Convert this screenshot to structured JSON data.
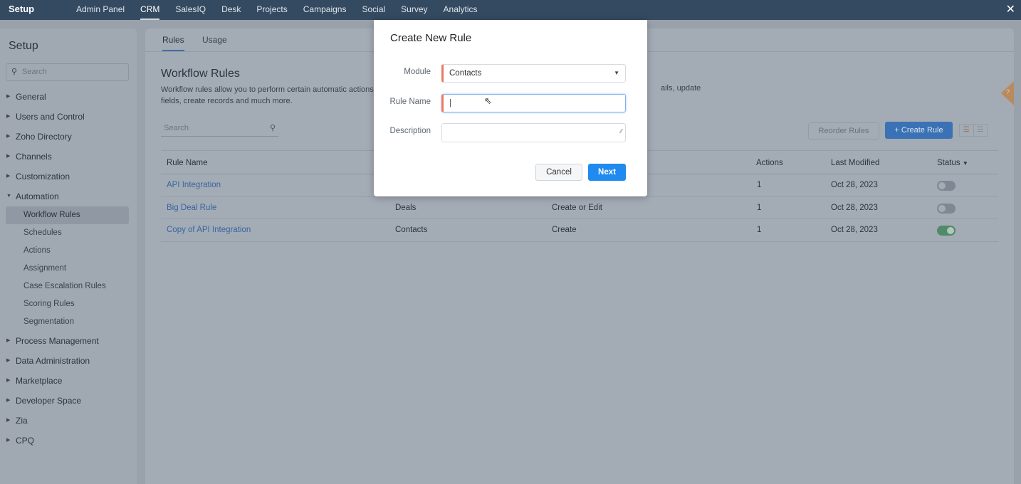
{
  "topbar": {
    "brand": "Setup",
    "nav": [
      "Admin Panel",
      "CRM",
      "SalesIQ",
      "Desk",
      "Projects",
      "Campaigns",
      "Social",
      "Survey",
      "Analytics"
    ],
    "active": "CRM",
    "close_icon": "close-icon"
  },
  "sidebar": {
    "title": "Setup",
    "search_placeholder": "Search",
    "items": [
      {
        "label": "General"
      },
      {
        "label": "Users and Control"
      },
      {
        "label": "Zoho Directory"
      },
      {
        "label": "Channels"
      },
      {
        "label": "Customization"
      },
      {
        "label": "Automation",
        "expanded": true,
        "children": [
          "Workflow Rules",
          "Schedules",
          "Actions",
          "Assignment",
          "Case Escalation Rules",
          "Scoring Rules",
          "Segmentation"
        ],
        "active_child": "Workflow Rules"
      },
      {
        "label": "Process Management"
      },
      {
        "label": "Data Administration"
      },
      {
        "label": "Marketplace"
      },
      {
        "label": "Developer Space"
      },
      {
        "label": "Zia"
      },
      {
        "label": "CPQ"
      }
    ]
  },
  "main": {
    "tabs": [
      "Rules",
      "Usage"
    ],
    "active_tab": "Rules",
    "title": "Workflow Rules",
    "description_line1_start": "Workflow rules allow you to perform certain automatic actions",
    "description_line1_end": "ails, update",
    "description_line2": "fields, create records and much more.",
    "search_placeholder": "Search",
    "reorder_label": "Reorder Rules",
    "create_label": "+ Create Rule",
    "table": {
      "headers": [
        "Rule Name",
        "Actions",
        "Last Modified",
        "Status"
      ],
      "rows": [
        {
          "name": "API Integration",
          "module": "",
          "trigger": "",
          "actions": "1",
          "modified": "Oct 28, 2023",
          "status": false
        },
        {
          "name": "Big Deal Rule",
          "module": "Deals",
          "trigger": "Create or Edit",
          "actions": "1",
          "modified": "Oct 28, 2023",
          "status": false
        },
        {
          "name": "Copy of API Integration",
          "module": "Contacts",
          "trigger": "Create",
          "actions": "1",
          "modified": "Oct 28, 2023",
          "status": true
        }
      ]
    },
    "help": "?"
  },
  "modal": {
    "title": "Create New Rule",
    "module_label": "Module",
    "module_value": "Contacts",
    "rule_name_label": "Rule Name",
    "rule_name_value": "",
    "description_label": "Description",
    "description_value": "",
    "cancel_label": "Cancel",
    "next_label": "Next"
  },
  "colors": {
    "topbar": "#344a61",
    "primary": "#1f8aef",
    "required": "#e87b62",
    "toggle_on": "#4f8a69"
  }
}
